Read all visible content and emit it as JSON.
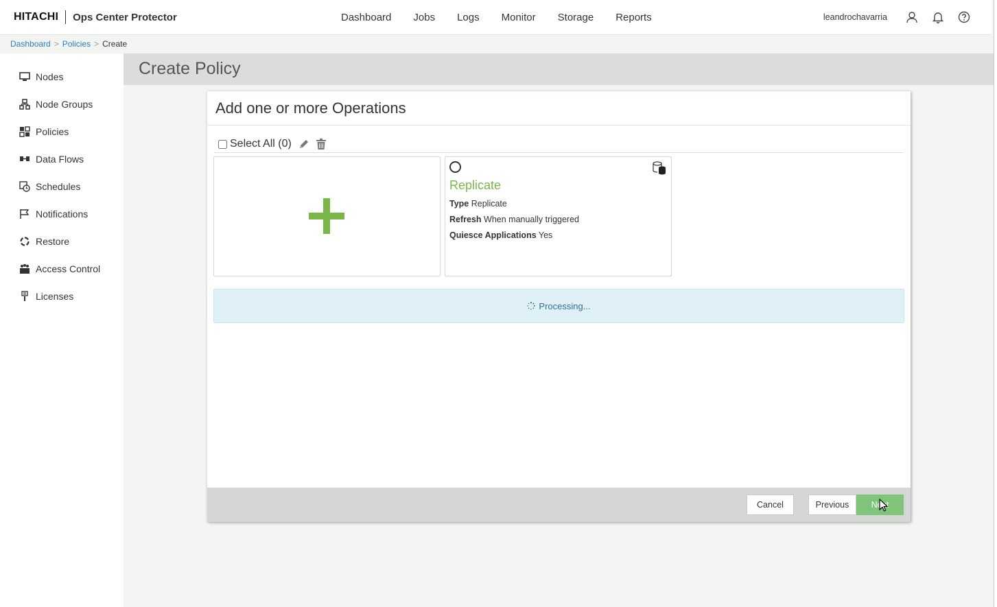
{
  "header": {
    "brand_logo": "HITACHI",
    "product_name": "Ops Center Protector",
    "nav": [
      "Dashboard",
      "Jobs",
      "Logs",
      "Monitor",
      "Storage",
      "Reports"
    ],
    "username": "leandrochavarria",
    "icons": [
      "user-icon",
      "bell-icon",
      "help-icon"
    ]
  },
  "breadcrumb": {
    "items": [
      "Dashboard",
      "Policies"
    ],
    "separator": ">",
    "current": "Create"
  },
  "sidebar": {
    "items": [
      {
        "label": "Nodes",
        "icon": "monitor-icon"
      },
      {
        "label": "Node Groups",
        "icon": "node-groups-icon"
      },
      {
        "label": "Policies",
        "icon": "policies-icon"
      },
      {
        "label": "Data Flows",
        "icon": "data-flows-icon"
      },
      {
        "label": "Schedules",
        "icon": "schedules-icon"
      },
      {
        "label": "Notifications",
        "icon": "flag-icon"
      },
      {
        "label": "Restore",
        "icon": "restore-icon"
      },
      {
        "label": "Access Control",
        "icon": "access-control-icon"
      },
      {
        "label": "Licenses",
        "icon": "license-icon"
      }
    ]
  },
  "page": {
    "title": "Create Policy"
  },
  "dialog": {
    "title": "Add one or more Operations",
    "select_all_label": "Select All (0)",
    "toolbar_icons": [
      "pencil-icon",
      "trash-icon"
    ],
    "operation": {
      "name": "Replicate",
      "rows": [
        {
          "label": "Type",
          "value": "Replicate"
        },
        {
          "label": "Refresh",
          "value": "When manually triggered"
        },
        {
          "label": "Quiesce Applications",
          "value": "Yes"
        }
      ]
    },
    "processing_text": "Processing...",
    "buttons": {
      "cancel": "Cancel",
      "previous": "Previous",
      "next": "Next"
    }
  },
  "colors": {
    "accent_green": "#7ab648",
    "next_button": "#7ec57a",
    "link_blue": "#2c7dbd",
    "info_bg": "#dff0f7",
    "title_bar": "#dcdcdc"
  }
}
